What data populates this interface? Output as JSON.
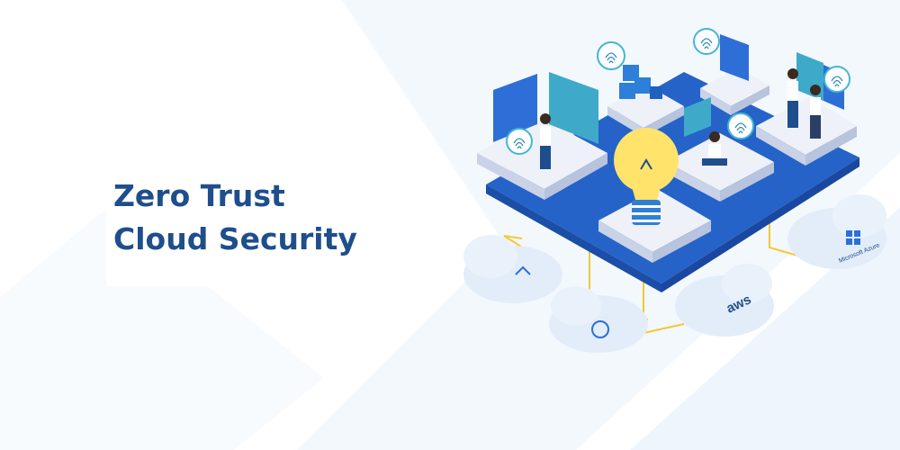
{
  "hero": {
    "title_line1": "Zero Trust",
    "title_line2": "Cloud Security"
  },
  "clouds": {
    "aws_label": "aws",
    "azure_label": "Microsoft Azure"
  },
  "colors": {
    "title": "#1f4e8c",
    "platform": "#2563c9",
    "tile": "#eef1f8",
    "bulb": "#ffe36b",
    "wire": "#f4c735",
    "cloud": "#e2edf9",
    "panel_teal": "#3fa9c9"
  }
}
